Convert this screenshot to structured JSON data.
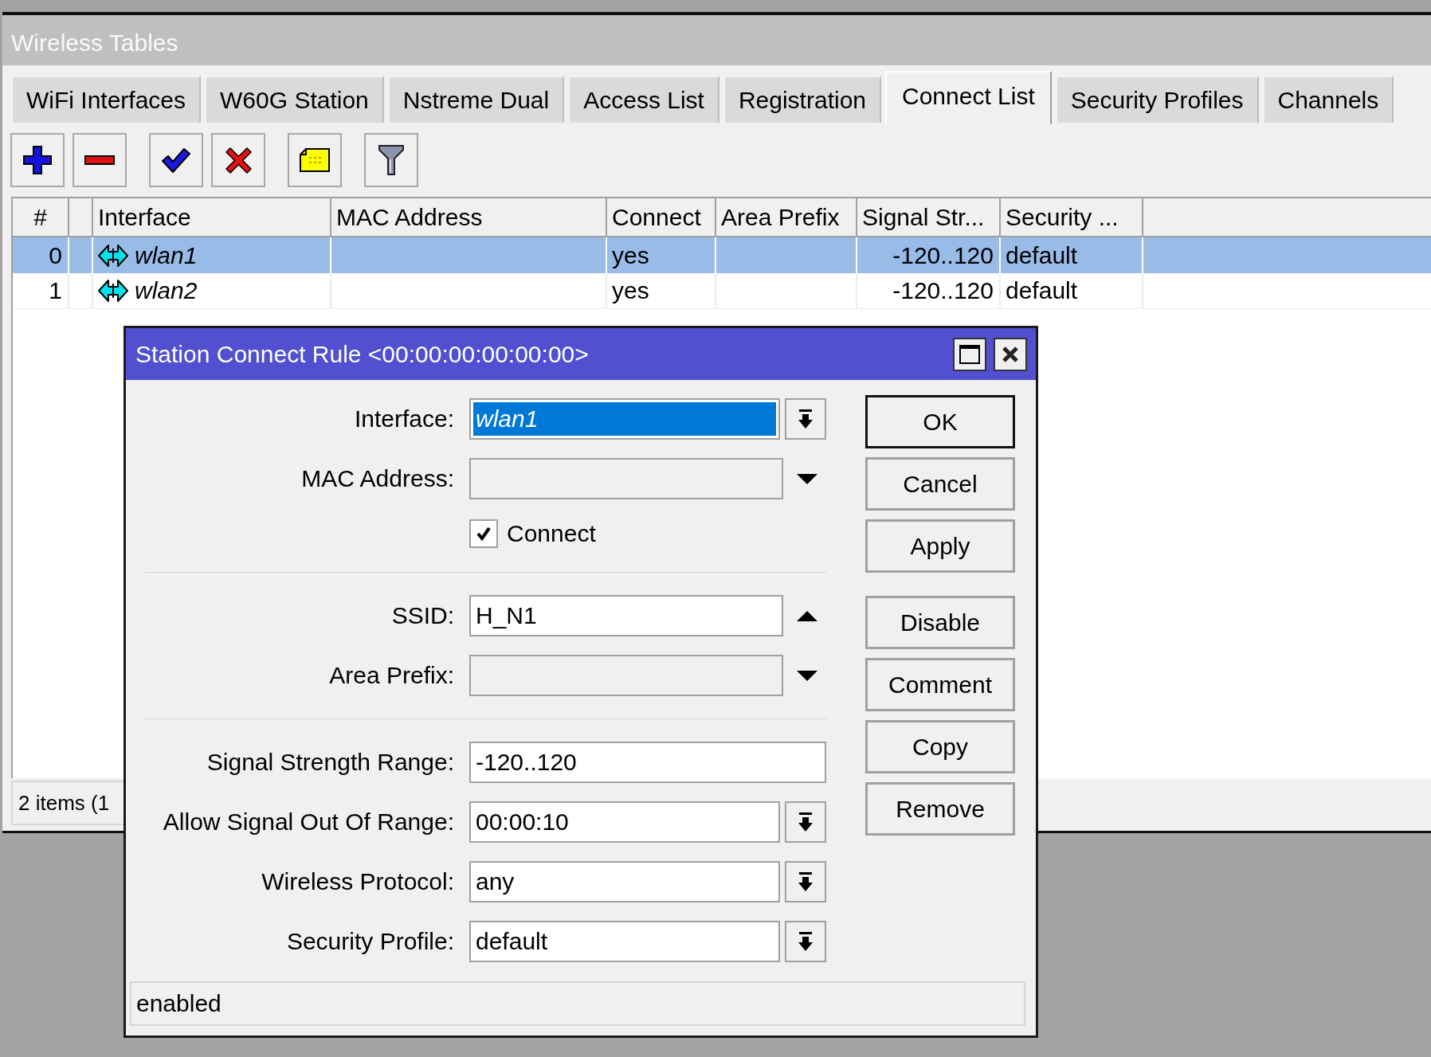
{
  "window": {
    "title": "Wireless Tables"
  },
  "tabs": [
    {
      "label": "WiFi Interfaces",
      "selected": false
    },
    {
      "label": "W60G Station",
      "selected": false
    },
    {
      "label": "Nstreme Dual",
      "selected": false
    },
    {
      "label": "Access List",
      "selected": false
    },
    {
      "label": "Registration",
      "selected": false
    },
    {
      "label": "Connect List",
      "selected": true
    },
    {
      "label": "Security Profiles",
      "selected": false
    },
    {
      "label": "Channels",
      "selected": false
    }
  ],
  "table": {
    "columns": [
      "#",
      "Interface",
      "MAC Address",
      "Connect",
      "Area Prefix",
      "Signal Str...",
      "Security ..."
    ],
    "rows": [
      {
        "selected": true,
        "number": "0",
        "interface": "wlan1",
        "connect": "yes",
        "signal_strength": "-120..120",
        "security_profile": "default"
      },
      {
        "selected": false,
        "number": "1",
        "interface": "wlan2",
        "connect": "yes",
        "signal_strength": "-120..120",
        "security_profile": "default"
      }
    ]
  },
  "status_bar": {
    "text": "2 items (1"
  },
  "dialog": {
    "title": "Station Connect Rule <00:00:00:00:00:00>",
    "sections": [
      [
        {
          "kind": "select",
          "label": "Interface:",
          "value": "wlan1",
          "italic": true,
          "highlighted": true
        },
        {
          "kind": "combo",
          "label": "MAC Address:",
          "expanded": false
        },
        {
          "kind": "checkbox",
          "label": "Connect",
          "checked": true
        }
      ],
      [
        {
          "kind": "combo",
          "label": "SSID:",
          "value": "H_N1",
          "expanded": true
        },
        {
          "kind": "combo",
          "label": "Area Prefix:",
          "expanded": false
        }
      ],
      [
        {
          "kind": "text",
          "label": "Signal Strength Range:",
          "value": "-120..120"
        },
        {
          "kind": "select",
          "label": "Allow Signal Out Of Range:",
          "value": "00:00:10"
        },
        {
          "kind": "select",
          "label": "Wireless Protocol:",
          "value": "any"
        },
        {
          "kind": "select",
          "label": "Security Profile:",
          "value": "default"
        }
      ]
    ],
    "button_groups": [
      [
        {
          "label": "OK",
          "default": true
        },
        {
          "label": "Cancel",
          "default": false
        },
        {
          "label": "Apply",
          "default": false
        }
      ],
      [
        {
          "label": "Disable",
          "default": false
        },
        {
          "label": "Comment",
          "default": false
        },
        {
          "label": "Copy",
          "default": false
        },
        {
          "label": "Remove",
          "default": false
        }
      ]
    ],
    "status": "enabled"
  }
}
